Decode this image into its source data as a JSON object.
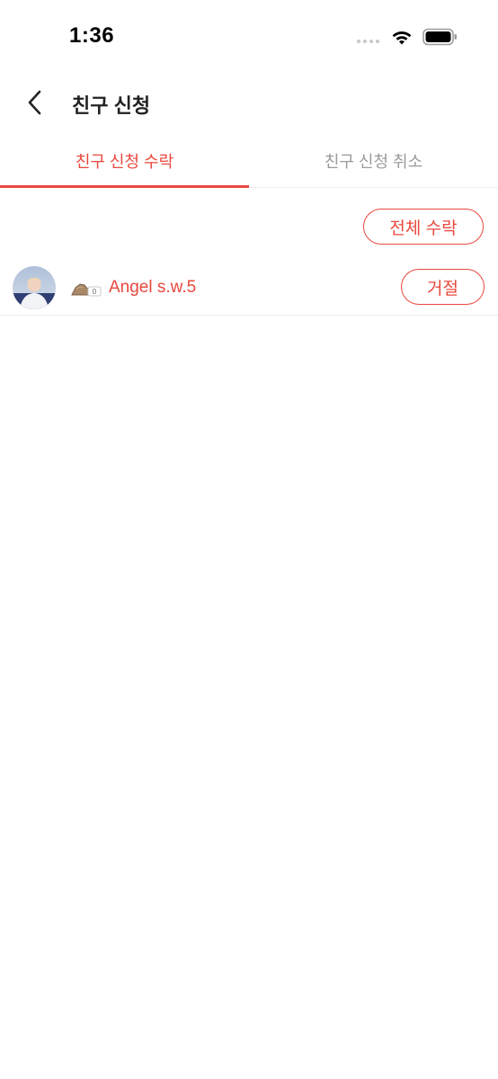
{
  "status_bar": {
    "time": "1:36"
  },
  "header": {
    "title": "친구 신청",
    "back_icon": "chevron-left-icon"
  },
  "tabs": [
    {
      "label": "친구 신청 수락",
      "active": true
    },
    {
      "label": "친구 신청 취소",
      "active": false
    }
  ],
  "actions": {
    "accept_all_label": "전체 수락"
  },
  "requests": [
    {
      "name": "Angel s.w.5",
      "level_badge": "0",
      "reject_label": "거절"
    }
  ],
  "colors": {
    "accent": "#e8483e",
    "inactive_tab": "#9a9a9a",
    "divider": "#ececec"
  }
}
